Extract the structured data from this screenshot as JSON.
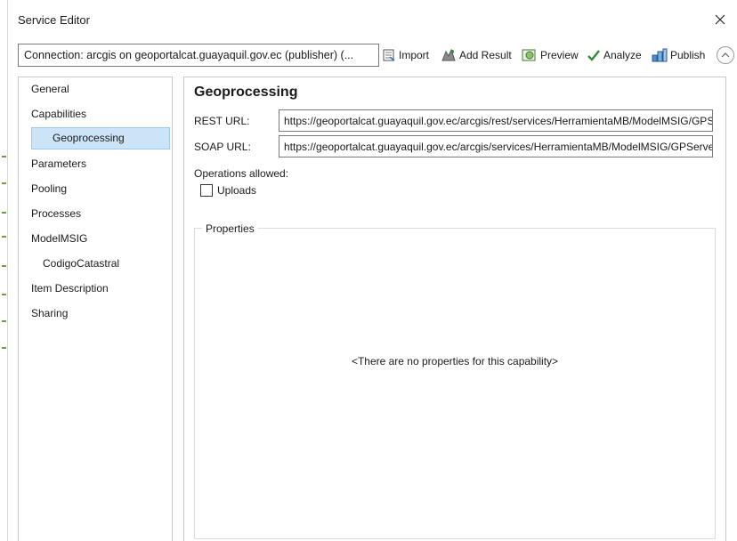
{
  "window": {
    "title": "Service Editor"
  },
  "toolbar": {
    "connection_text": "Connection: arcgis on geoportalcat.guayaquil.gov.ec (publisher) (...",
    "import_label": "Import",
    "add_result_label": "Add Result",
    "preview_label": "Preview",
    "analyze_label": "Analyze",
    "publish_label": "Publish"
  },
  "nav": {
    "items": [
      {
        "label": "General"
      },
      {
        "label": "Capabilities"
      },
      {
        "label": "Geoprocessing",
        "selected": true
      },
      {
        "label": "Parameters"
      },
      {
        "label": "Pooling"
      },
      {
        "label": "Processes"
      },
      {
        "label": "ModelMSIG"
      },
      {
        "label": "CodigoCatastral"
      },
      {
        "label": "Item Description"
      },
      {
        "label": "Sharing"
      }
    ]
  },
  "content": {
    "heading": "Geoprocessing",
    "rest_url_label": "REST URL:",
    "rest_url_value": "https://geoportalcat.guayaquil.gov.ec/arcgis/rest/services/HerramientaMB/ModelMSIG/GPServer",
    "soap_url_label": "SOAP URL:",
    "soap_url_value": "https://geoportalcat.guayaquil.gov.ec/arcgis/services/HerramientaMB/ModelMSIG/GPServer",
    "operations_label": "Operations allowed:",
    "uploads_label": "Uploads",
    "uploads_checked": false,
    "properties_legend": "Properties",
    "properties_empty": "<There are no properties for this capability>"
  },
  "colors": {
    "selection_bg": "#cce4f7",
    "selection_border": "#99c9ef",
    "analyze_check": "#2e8b2e"
  }
}
